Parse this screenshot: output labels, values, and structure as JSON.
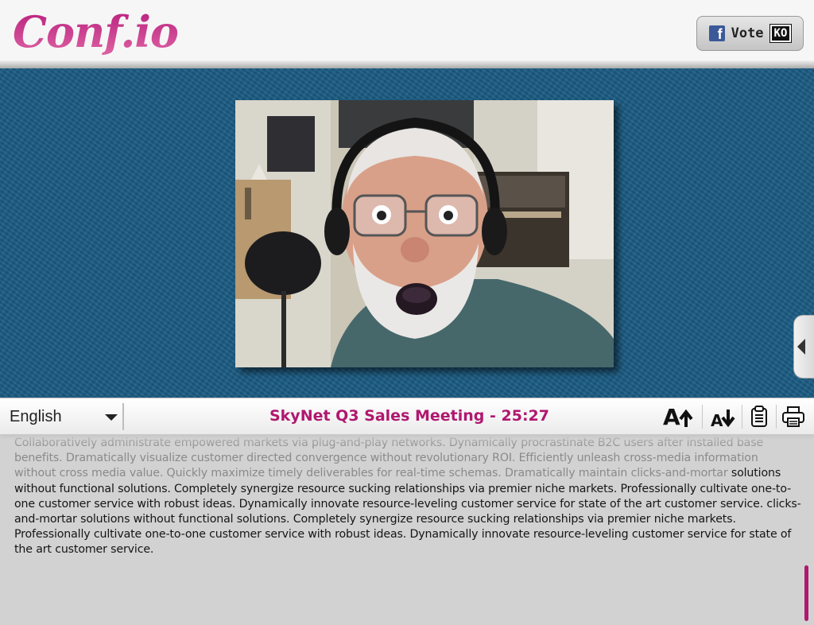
{
  "header": {
    "logo_text": "Conf.io",
    "vote_button": {
      "fb_letter": "f",
      "label": "Vote",
      "badge": "KO"
    }
  },
  "stage": {
    "video_alt": "webcam feed",
    "side_tab_icon": "chevron-left-icon"
  },
  "toolbar": {
    "language": "English",
    "meeting_title": "SkyNet Q3 Sales Meeting - 25:27",
    "buttons": [
      {
        "name": "increase-font",
        "icon": "font-increase-icon"
      },
      {
        "name": "decrease-font",
        "icon": "font-decrease-icon"
      },
      {
        "name": "copy",
        "icon": "clipboard-icon"
      },
      {
        "name": "print",
        "icon": "printer-icon"
      }
    ]
  },
  "transcript": {
    "faded_text": "Collaboratively administrate empowered markets via plug-and-play networks. Dynamically procrastinate B2C users after installed base benefits. Dramatically visualize customer directed convergence without revolutionary ROI. Efficiently unleash cross-media information without cross media value. Quickly maximize timely deliverables for real-time schemas. Dramatically maintain clicks-and-mortar",
    "text": " solutions without functional solutions. Completely synergize resource sucking relationships via premier niche markets. Professionally cultivate one-to-one customer service with robust ideas. Dynamically innovate resource-leveling customer service for state of the art customer service. clicks-and-mortar solutions without functional solutions. Completely synergize resource sucking relationships via premier niche markets. Professionally cultivate one-to-one customer service with robust ideas. Dynamically innovate resource-leveling customer service for state of the art customer service."
  },
  "colors": {
    "brand": "#b0176f",
    "stage_bg": "#1b5c83",
    "page_bg": "#d2d2d2"
  }
}
